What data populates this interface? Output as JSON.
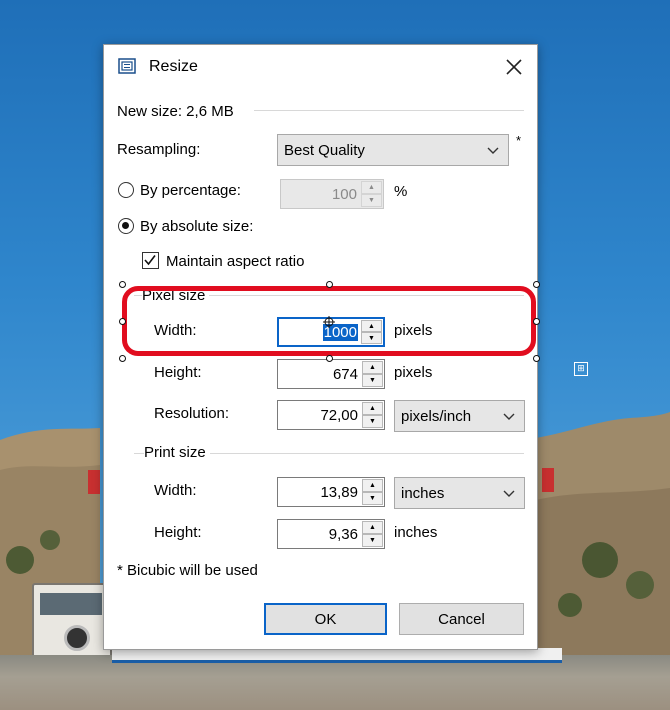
{
  "dialog": {
    "title": "Resize",
    "close_glyph": "✕",
    "new_size": "New size: 2,6 MB",
    "resampling": {
      "label": "Resampling:",
      "value": "Best Quality",
      "asterisk": "*"
    },
    "by_percentage": {
      "label": "By percentage:",
      "value": "100",
      "unit": "%",
      "selected": false,
      "enabled": false
    },
    "by_absolute": {
      "label": "By absolute size:",
      "selected": true
    },
    "maintain_aspect": {
      "label": "Maintain aspect ratio",
      "checked": true
    },
    "pixel_size": {
      "title": "Pixel size",
      "width": {
        "label": "Width:",
        "value": "1000",
        "unit": "pixels"
      },
      "height": {
        "label": "Height:",
        "value": "674",
        "unit": "pixels"
      },
      "resolution": {
        "label": "Resolution:",
        "value": "72,00",
        "unit": "pixels/inch"
      }
    },
    "print_size": {
      "title": "Print size",
      "width": {
        "label": "Width:",
        "value": "13,89",
        "unit": "inches"
      },
      "height": {
        "label": "Height:",
        "value": "9,36",
        "unit": "inches"
      }
    },
    "footnote": "* Bicubic will be used",
    "ok_label": "OK",
    "cancel_label": "Cancel"
  },
  "icons": {
    "title_icon": "resize-icon",
    "chevron": "chevron-down-icon",
    "spin_up": "▲",
    "spin_down": "▼",
    "checkmark": "✓"
  },
  "colors": {
    "accent": "#0a64c8",
    "highlight": "#e10d1f",
    "dialog_bg": "#ffffff",
    "sky": "#2f86cc"
  }
}
